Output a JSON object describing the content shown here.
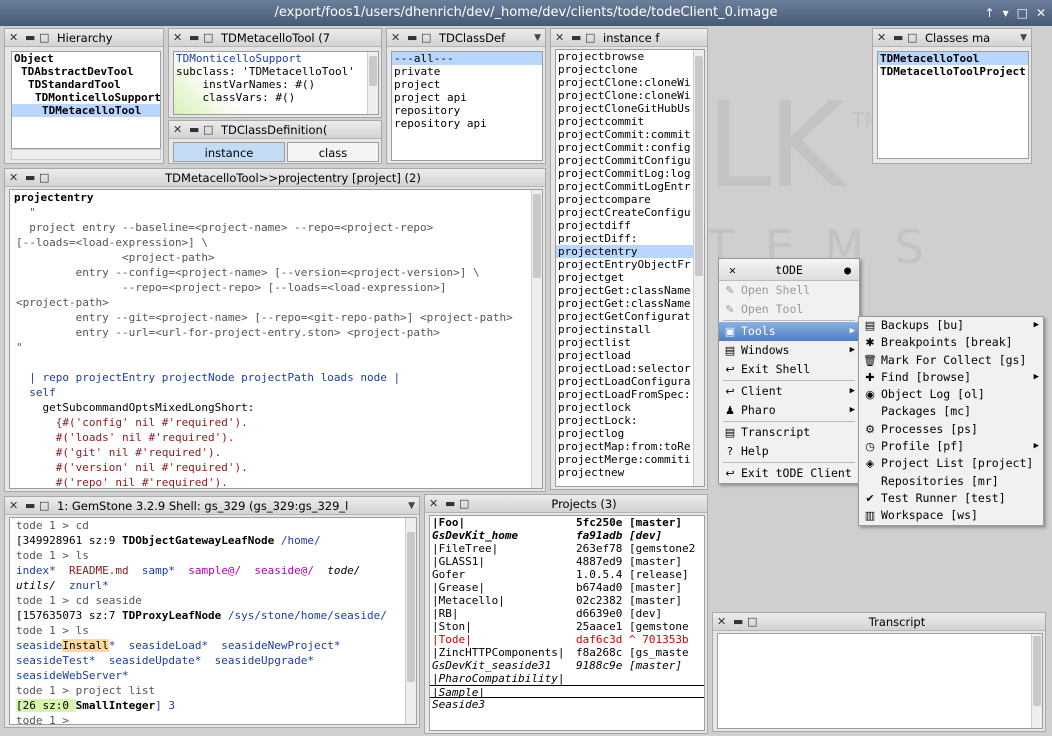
{
  "window": {
    "title": "/export/foos1/users/dhenrich/dev/_home/dev/clients/tode/todeClient_0.image",
    "controls": [
      "↑",
      "▾",
      "□",
      "✕"
    ]
  },
  "logo": {
    "big": "LK",
    "tm": "TM",
    "sub": "T E M S"
  },
  "hierarchy": {
    "title": "Hierarchy",
    "items": [
      "Object",
      "TDAbstractDevTool",
      "TDStandardTool",
      "TDMonticelloSupport",
      "TDMetacelloTool"
    ]
  },
  "classdef": {
    "title": "TDMetacelloTool (7",
    "lines": [
      "TDMonticelloSupport",
      "subclass: 'TDMetacelloTool'",
      "    instVarNames: #()",
      "    classVars: #()"
    ]
  },
  "classdef2": {
    "title": "TDClassDefinition(",
    "tabs": [
      "instance",
      "class"
    ]
  },
  "categories": {
    "title": "TDClassDef",
    "items": [
      "---all---",
      "private",
      "project",
      "project api",
      "repository",
      "repository api"
    ]
  },
  "methods": {
    "title": "instance f",
    "items": [
      "projectbrowse",
      "projectclone",
      "projectClone:cloneWi",
      "projectClone:cloneWi",
      "projectCloneGitHubUs",
      "projectcommit",
      "projectCommit:commit",
      "projectCommit:config",
      "projectCommitConfigu",
      "projectCommitLog:log",
      "projectCommitLogEntr",
      "projectcompare",
      "projectCreateConfigu",
      "projectdiff",
      "projectDiff:",
      "projectentry",
      "projectEntryObjectFr",
      "projectget",
      "projectGet:className",
      "projectGet:className",
      "projectGetConfigurat",
      "projectinstall",
      "projectlist",
      "projectload",
      "projectLoad:selector",
      "projectLoadConfigura",
      "projectLoadFromSpec:",
      "projectlock",
      "projectLock:",
      "projectlog",
      "projectMap:from:toRe",
      "projectMerge:commiti",
      "projectnew"
    ],
    "selected": 15
  },
  "classes": {
    "title": "Classes ma",
    "items": [
      "TDMetacelloTool",
      "TDMetacelloToolProject"
    ]
  },
  "method_editor": {
    "title": "TDMetacelloTool>>projectentry [project] (2)",
    "header": "projectentry",
    "comment": [
      "  \"",
      "  project entry --baseline=<project-name> --repo=<project-repo>",
      "[--loads=<load-expression>] \\",
      "                <project-path>",
      "         entry --config=<project-name> [--version=<project-version>] \\",
      "                --repo=<project-repo> [--loads=<load-expression>]",
      "<project-path>",
      "         entry --git=<project-name> [--repo=<git-repo-path>] <project-path>",
      "         entry --url=<url-for-project-entry.ston> <project-path>",
      "\""
    ],
    "code": [
      "  | repo projectEntry projectNode projectPath loads node |",
      "  self",
      "    getSubcommandOptsMixedLongShort:",
      "      {#('config' nil #'required').",
      "      #('loads' nil #'required').",
      "      #('git' nil #'required').",
      "      #('version' nil #'required').",
      "      #('repo' nil #'required')."
    ]
  },
  "shell": {
    "title": "1: GemStone 3.2.9 Shell: gs_329 (gs_329:gs_329_l",
    "lines": [
      [
        [
          "tode 1 > cd",
          "g"
        ]
      ],
      [
        [
          "[349928961 sz:9 ",
          ""
        ],
        [
          "TDObjectGatewayLeafNode",
          "bold"
        ],
        [
          " /home/",
          "b"
        ]
      ],
      [
        [
          "tode 1 > ls",
          "g"
        ]
      ],
      [
        [
          "index* ",
          "b"
        ],
        [
          " README.md ",
          "str"
        ],
        [
          " samp* ",
          "b"
        ],
        [
          " sample@/ ",
          "pk"
        ],
        [
          " seaside@/ ",
          "pk"
        ],
        [
          " tode/",
          "it"
        ]
      ],
      [
        [
          "utils/ ",
          "it"
        ],
        [
          " znurl*",
          "b"
        ]
      ],
      [
        [
          "tode 1 > cd seaside",
          "g"
        ]
      ],
      [
        [
          "[157635073 sz:7 ",
          ""
        ],
        [
          "TDProxyLeafNode",
          "bold"
        ],
        [
          " /sys/stone/home/seaside/",
          "b"
        ]
      ],
      [
        [
          "tode 1 > ls",
          "g"
        ]
      ],
      [
        [
          "seaside",
          "b"
        ],
        [
          "Install",
          "hlw"
        ],
        [
          "* ",
          "b"
        ],
        [
          " seasideLoad* ",
          "b"
        ],
        [
          " seasideNewProject*",
          "b"
        ]
      ],
      [
        [
          "seasideTest* ",
          "b"
        ],
        [
          " seasideUpdate* ",
          "b"
        ],
        [
          " seasideUpgrade*",
          "b"
        ]
      ],
      [
        [
          "seasideWebServer*",
          "b"
        ]
      ],
      [
        [
          "tode 1 > project list",
          "g"
        ]
      ],
      [
        [
          "[26 sz:0 ",
          "hlg"
        ],
        [
          "SmallInteger",
          "bold"
        ],
        [
          "] 3",
          "b"
        ]
      ],
      [
        [
          "tode 1 > ",
          "g"
        ]
      ]
    ]
  },
  "projects": {
    "title": "Projects (3)",
    "rows": [
      {
        "name": "|Foo|",
        "ver": "5fc250e [master]",
        "style": "bold"
      },
      {
        "name": "GsDevKit_home",
        "ver": "fa91adb [dev]",
        "style": "bolditalic"
      },
      {
        "name": "|FileTree|",
        "ver": "263ef78 [gemstone2",
        "style": ""
      },
      {
        "name": "|GLASS1|",
        "ver": "4887ed9 [master]",
        "style": ""
      },
      {
        "name": "Gofer",
        "ver": "1.0.5.4 [release]",
        "style": ""
      },
      {
        "name": "|Grease|",
        "ver": "b674ad0 [master]",
        "style": ""
      },
      {
        "name": "|Metacello|",
        "ver": "02c2382 [master]",
        "style": ""
      },
      {
        "name": "|RB|",
        "ver": "d6639e0 [dev]",
        "style": ""
      },
      {
        "name": "|Ston|",
        "ver": "25aace1 [gemstone",
        "style": ""
      },
      {
        "name": "|Tode|",
        "ver": "daf6c3d ^ 701353b",
        "style": "red"
      },
      {
        "name": "|ZincHTTPComponents|",
        "ver": "f8a268c [gs_maste",
        "style": ""
      },
      {
        "name": "GsDevKit_seaside31",
        "ver": "9188c9e [master]",
        "style": "italic"
      },
      {
        "name": "|PharoCompatibility|",
        "ver": "",
        "style": "italic"
      },
      {
        "name": "|Sample|",
        "ver": "",
        "style": "italic"
      },
      {
        "name": "Seaside3",
        "ver": "",
        "style": "italic"
      }
    ]
  },
  "transcript": {
    "title": "Transcript"
  },
  "tode_menu": {
    "title": "tODE",
    "items": [
      {
        "label": "Open Shell",
        "icon": "✎",
        "state": "dis",
        "arrow": false
      },
      {
        "label": "Open Tool",
        "icon": "✎",
        "state": "dis",
        "arrow": false
      },
      {
        "sep": true
      },
      {
        "label": "Tools",
        "icon": "▣",
        "state": "hl",
        "arrow": true
      },
      {
        "label": "Windows",
        "icon": "▤",
        "state": "",
        "arrow": true
      },
      {
        "label": "Exit Shell",
        "icon": "↩",
        "state": "",
        "arrow": false
      },
      {
        "sep": true
      },
      {
        "label": "Client",
        "icon": "↩",
        "state": "",
        "arrow": true
      },
      {
        "label": "Pharo",
        "icon": "♟",
        "state": "",
        "arrow": true
      },
      {
        "sep": true
      },
      {
        "label": "Transcript",
        "icon": "▤",
        "state": "",
        "arrow": false
      },
      {
        "label": "Help",
        "icon": "?",
        "state": "",
        "arrow": false
      },
      {
        "sep": true
      },
      {
        "label": "Exit tODE Client",
        "icon": "↩",
        "state": "",
        "arrow": false
      }
    ]
  },
  "tools_menu": {
    "items": [
      {
        "label": "Backups [bu]",
        "icon": "▤",
        "arrow": true
      },
      {
        "label": "Breakpoints [break]",
        "icon": "✱",
        "arrow": false
      },
      {
        "label": "Mark For Collect [gs]",
        "icon": "🗑",
        "arrow": false
      },
      {
        "label": "Find [browse]",
        "icon": "✚",
        "arrow": true
      },
      {
        "label": "Object Log [ol]",
        "icon": "◉",
        "arrow": false
      },
      {
        "label": "Packages [mc]",
        "icon": "",
        "arrow": false
      },
      {
        "label": "Processes [ps]",
        "icon": "⚙",
        "arrow": false
      },
      {
        "label": "Profile [pf]",
        "icon": "◷",
        "arrow": true
      },
      {
        "label": "Project List [project]",
        "icon": "◈",
        "arrow": false
      },
      {
        "label": "Repositories [mr]",
        "icon": "",
        "arrow": false
      },
      {
        "label": "Test Runner [test]",
        "icon": "✔",
        "arrow": false
      },
      {
        "label": "Workspace [ws]",
        "icon": "▥",
        "arrow": false
      }
    ]
  }
}
